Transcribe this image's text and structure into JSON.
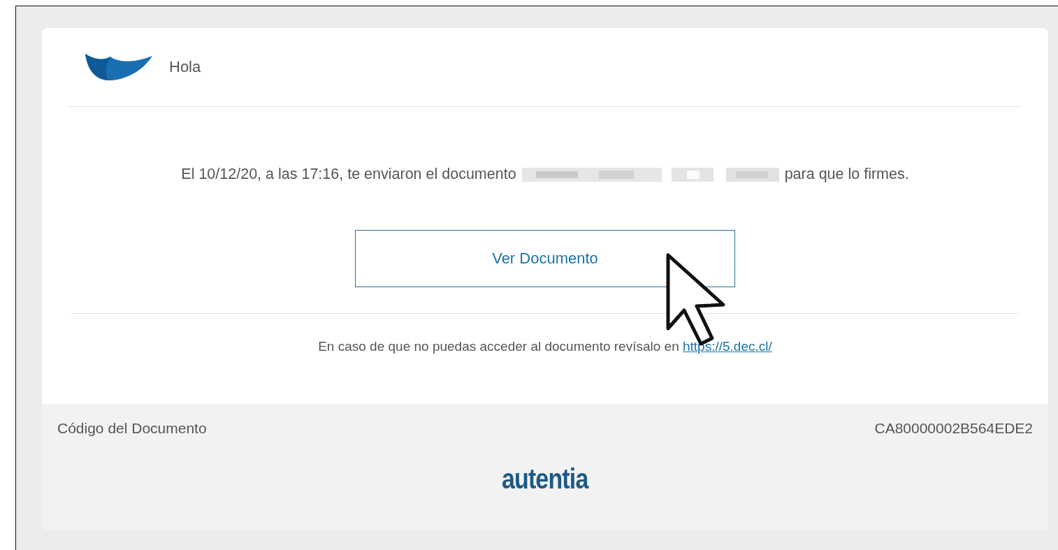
{
  "greeting": "Hola",
  "message": {
    "before": "El 10/12/20, a las 17:16, te enviaron el documento",
    "after": "para que lo firmes."
  },
  "button": "Ver Documento",
  "fallback": {
    "text": "En caso de que no puedas acceder al documento revísalo en",
    "link": "https://5.dec.cl/"
  },
  "footer": {
    "code_label": "Código del Documento",
    "code": "CA80000002B564EDE2",
    "brand": "autentia"
  }
}
